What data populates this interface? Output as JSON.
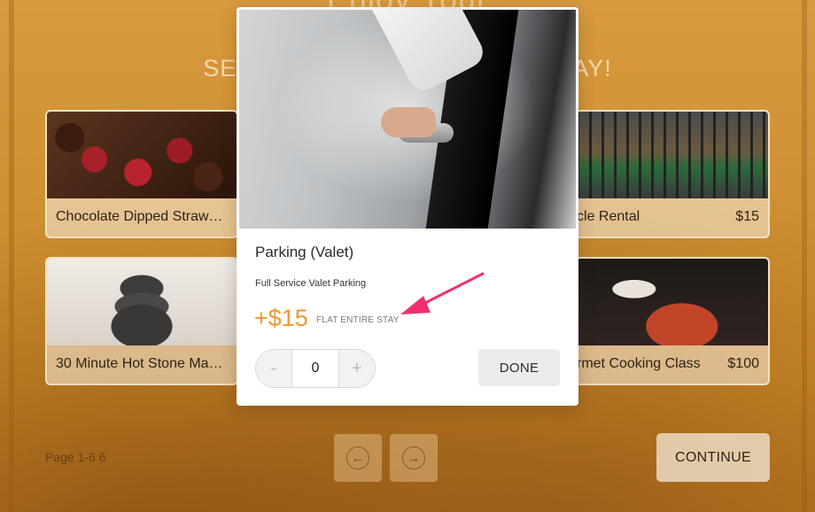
{
  "page": {
    "headline_top": "Enjoy Your",
    "headline": "SELECT PERKS FOR YOUR STAY!"
  },
  "cards": [
    {
      "label": "Chocolate Dipped Straw…",
      "price": "",
      "image": "chocolate-strawberries"
    },
    {
      "label": "Bicycle Rental",
      "visible_label": "cle Rental",
      "price": "$15",
      "image": "bicycles"
    },
    {
      "label": "30 Minute Hot Stone Mas…",
      "price": "",
      "image": "hot-stones"
    },
    {
      "label": "Gourmet Cooking Class",
      "visible_label": "rmet Cooking Class",
      "price": "$100",
      "image": "cooking"
    }
  ],
  "pagination": {
    "info": "Page 1-6  6",
    "prev_icon": "arrow-left-circle-icon",
    "next_icon": "arrow-right-circle-icon"
  },
  "footer": {
    "continue_label": "CONTINUE"
  },
  "modal": {
    "title": "Parking (Valet)",
    "description": "Full Service Valet Parking",
    "price": "+$15",
    "price_unit": "FLAT ENTIRE STAY",
    "quantity": "0",
    "minus_label": "-",
    "plus_label": "+",
    "done_label": "DONE",
    "image": "valet-car-door"
  },
  "colors": {
    "accent_price": "#f0972c",
    "annotation_arrow": "#f0306e",
    "overlay": "#cf8f33"
  }
}
